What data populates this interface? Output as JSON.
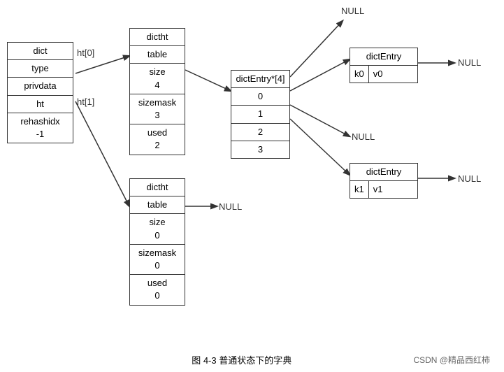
{
  "diagram": {
    "title": "图 4-3    普通状态下的字典",
    "watermark": "CSDN @精品西红柿",
    "dict_box": {
      "label": "dict",
      "cells": [
        "dict",
        "type",
        "privdata",
        "ht",
        "rehashidx\n-1"
      ]
    },
    "ht_labels": {
      "ht0": "ht[0]",
      "ht1": "ht[1]"
    },
    "dictht_top": {
      "cells": [
        "dictht",
        "table",
        "size\n4",
        "sizemask\n3",
        "used\n2"
      ]
    },
    "dictht_bottom": {
      "cells": [
        "dictht",
        "table",
        "size\n0",
        "sizemask\n0",
        "used\n0"
      ]
    },
    "dict_entry_array": {
      "header": "dictEntry*[4]",
      "rows": [
        "0",
        "1",
        "2",
        "3"
      ]
    },
    "dict_entry_top": {
      "label": "dictEntry",
      "k": "k0",
      "v": "v0"
    },
    "dict_entry_bottom": {
      "label": "dictEntry",
      "k": "k1",
      "v": "v1"
    },
    "null_labels": [
      "NULL",
      "NULL",
      "NULL",
      "NULL",
      "NULL"
    ]
  }
}
